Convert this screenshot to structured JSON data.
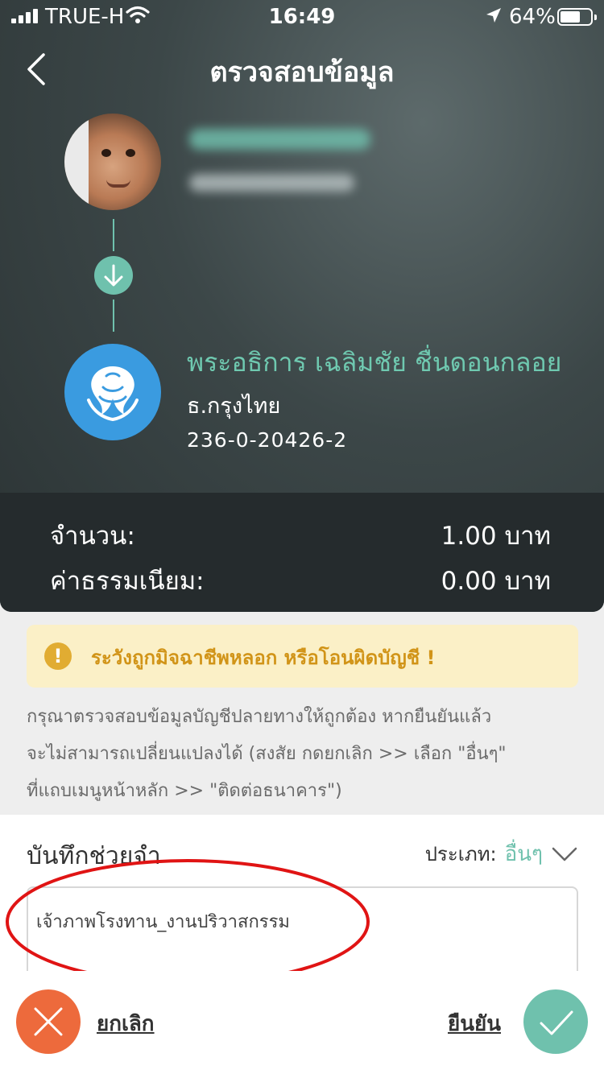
{
  "status_bar": {
    "carrier": "TRUE-H",
    "time": "16:49",
    "battery": "64%"
  },
  "header": {
    "title": "ตรวจสอบข้อมูล"
  },
  "recipient": {
    "name": "พระอธิการ เฉลิมชัย ชื่นดอนกลอย",
    "bank": "ธ.กรุงไทย",
    "account": "236-0-20426-2"
  },
  "summary": {
    "amount_label": "จำนวน:",
    "amount_value": "1.00 บาท",
    "fee_label": "ค่าธรรมเนียม:",
    "fee_value": "0.00 บาท"
  },
  "warning": {
    "text": "ระวังถูกมิจฉาชีพหลอก หรือโอนผิดบัญชี !"
  },
  "instructions": {
    "line1": "กรุณาตรวจสอบข้อมูลบัญชีปลายทางให้ถูกต้อง หากยืนยันแล้ว",
    "line2": "จะไม่สามารถเปลี่ยนแปลงได้ (สงสัย กดยกเลิก >> เลือก \"อื่นๆ\"",
    "line3": "ที่แถบเมนูหน้าหลัก >> \"ติดต่อธนาคาร\")"
  },
  "memo": {
    "title": "บันทึกช่วยจำ",
    "type_label": "ประเภท:",
    "type_value": "อื่นๆ",
    "value": "เจ้าภาพโรงทาน_งานปริวาสกรรม"
  },
  "footer": {
    "cancel_label": "ยกเลิก",
    "confirm_label": "ยืนยัน"
  },
  "colors": {
    "accent": "#6fc1ad",
    "cancel": "#ed6a3c",
    "warning_text": "#d19418",
    "warning_bg": "#fbf0c7",
    "bank_blue": "#3a9be0"
  },
  "icons": {
    "back": "chevron-left-icon",
    "arrow": "arrow-down-icon",
    "warning": "exclamation-icon",
    "dropdown": "chevron-down-icon",
    "cancel": "close-icon",
    "confirm": "check-icon"
  }
}
